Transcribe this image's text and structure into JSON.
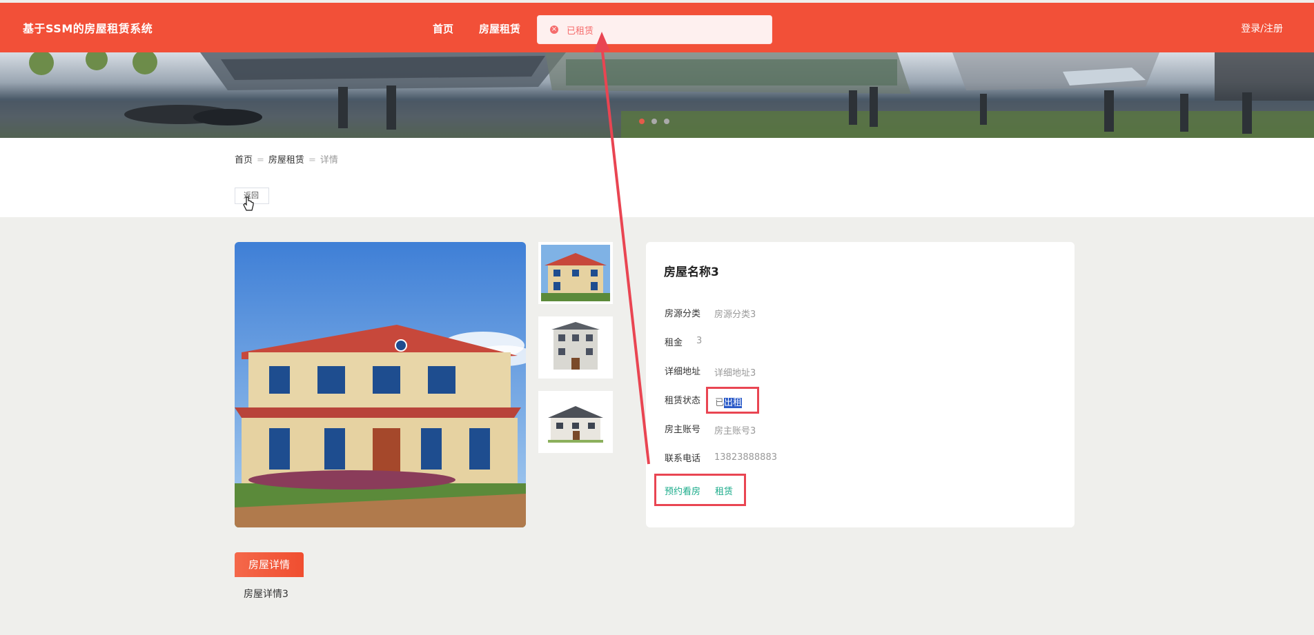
{
  "header": {
    "brand": "基于SSM的房屋租赁系统",
    "nav": [
      "首页",
      "房屋租赁"
    ],
    "login": "登录/注册",
    "bg_color": "#f25038"
  },
  "toast": {
    "icon": "error-icon",
    "message": "已租赁",
    "color": "#f56c6c"
  },
  "breadcrumb": {
    "home": "首页",
    "rent": "房屋租赁",
    "current": "详情"
  },
  "back_button": "返回",
  "house": {
    "title": "房屋名称3",
    "fields": [
      {
        "label": "房源分类",
        "value": "房源分类3"
      },
      {
        "label": "租金",
        "value": "3"
      },
      {
        "label": "详细地址",
        "value": "详细地址3"
      },
      {
        "label": "租赁状态",
        "value_prefix": "已",
        "value_selected": "出租"
      },
      {
        "label": "房主账号",
        "value": "房主账号3"
      },
      {
        "label": "联系电话",
        "value": "13823888883"
      }
    ],
    "actions": {
      "view_booking": "预约看房",
      "rent": "租赁"
    },
    "action_color": "#1aab8a"
  },
  "detail": {
    "tab": "房屋详情",
    "content": "房屋详情3"
  },
  "annotation_color": "#e94552"
}
